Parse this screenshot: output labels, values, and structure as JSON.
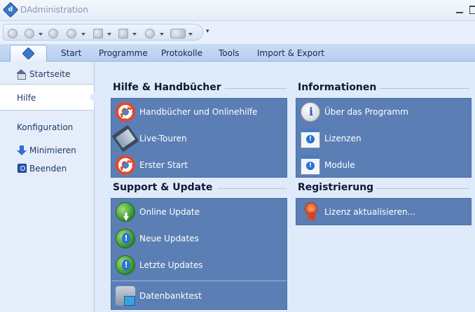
{
  "window": {
    "title": "DAdministration"
  },
  "ribbon": {
    "tabs": [
      "Start",
      "Programme",
      "Protokolle",
      "Tools",
      "Import & Export"
    ]
  },
  "sidebar": {
    "items": [
      {
        "label": "Startseite",
        "icon": "house-icon"
      },
      {
        "label": "Hilfe",
        "selected": true
      },
      {
        "label": "Konfiguration"
      },
      {
        "label": "Minimieren",
        "icon": "arrow-down-icon"
      },
      {
        "label": "Beenden",
        "icon": "power-icon"
      }
    ]
  },
  "sections": {
    "help": {
      "title": "Hilfe & Handbücher",
      "items": [
        {
          "label": "Handbücher und Onlinehilfe",
          "icon": "lifebuoy-icon"
        },
        {
          "label": "Live-Touren",
          "icon": "film-icon"
        },
        {
          "label": "Erster Start",
          "icon": "lifebuoy-icon"
        }
      ]
    },
    "support": {
      "title": "Support & Update",
      "items": [
        {
          "label": "Online Update",
          "icon": "globe-download-icon"
        },
        {
          "label": "Neue Updates",
          "icon": "globe-info-icon"
        },
        {
          "label": "Letzte Updates",
          "icon": "globe-info-icon"
        },
        {
          "label": "Datenbanktest",
          "icon": "database-test-icon"
        }
      ]
    },
    "info": {
      "title": "Informationen",
      "items": [
        {
          "label": "Über das Programm",
          "icon": "info-bubble-icon"
        },
        {
          "label": "Lizenzen",
          "icon": "window-info-icon"
        },
        {
          "label": "Module",
          "icon": "window-info-icon"
        }
      ]
    },
    "registration": {
      "title": "Registrierung",
      "items": [
        {
          "label": "Lizenz aktualisieren...",
          "icon": "award-ribbon-icon"
        }
      ]
    }
  },
  "colors": {
    "panel": "#5b7fb5",
    "background": "#dfeafa",
    "ribbon": "#b7cfee"
  }
}
